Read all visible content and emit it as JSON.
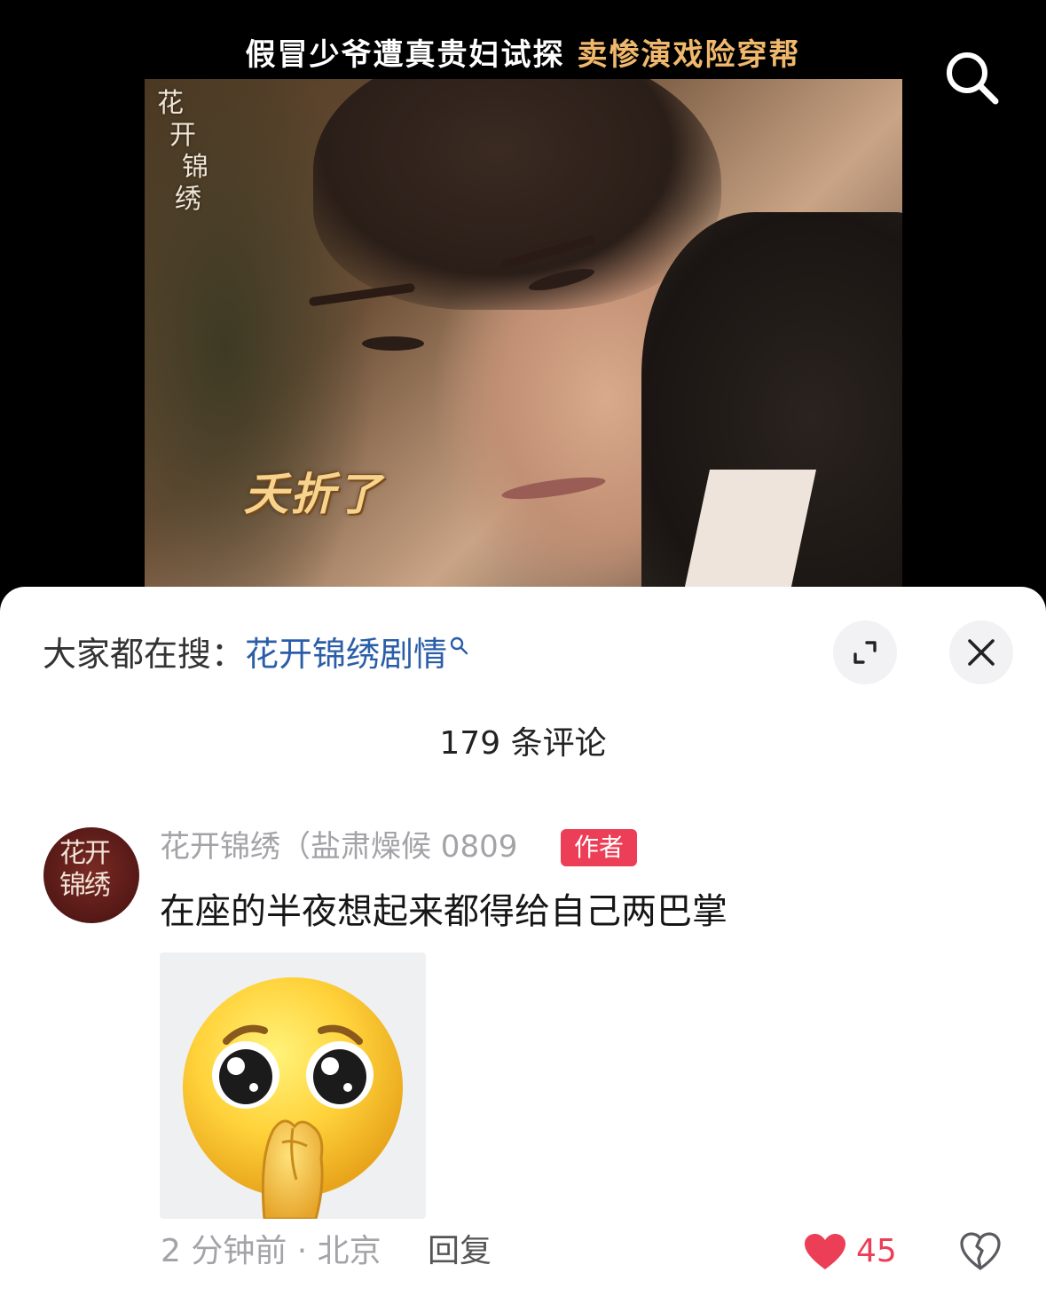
{
  "video": {
    "title_part1": "假冒少爷遭真贵妇试探",
    "title_part2": "卖惨演戏险穿帮",
    "show_logo": [
      "花",
      "开",
      "锦",
      "绣"
    ],
    "subtitle": "夭折了",
    "search_icon": "search-icon"
  },
  "sheet": {
    "trending_label": "大家都在搜：",
    "trending_query": "花开锦绣剧情",
    "expand_icon": "expand-icon",
    "close_icon": "close-icon",
    "comment_count": "179 条评论"
  },
  "comment": {
    "avatar_text": "花开锦绣",
    "username": "花开锦绣（盐肃燥候 0809",
    "badge": "作者",
    "text": "在座的半夜想起来都得给自己两巴掌",
    "sticker": "pleading-face-emoji",
    "time": "2 分钟前",
    "location": "北京",
    "meta": "2 分钟前 · 北京",
    "reply_label": "回复",
    "likes": "45",
    "liked": true
  },
  "colors": {
    "accent_red": "#ec3f57",
    "link_blue": "#2b5ea8",
    "title_gold": "#f0b86c",
    "muted_gray": "#a3a3a8"
  }
}
